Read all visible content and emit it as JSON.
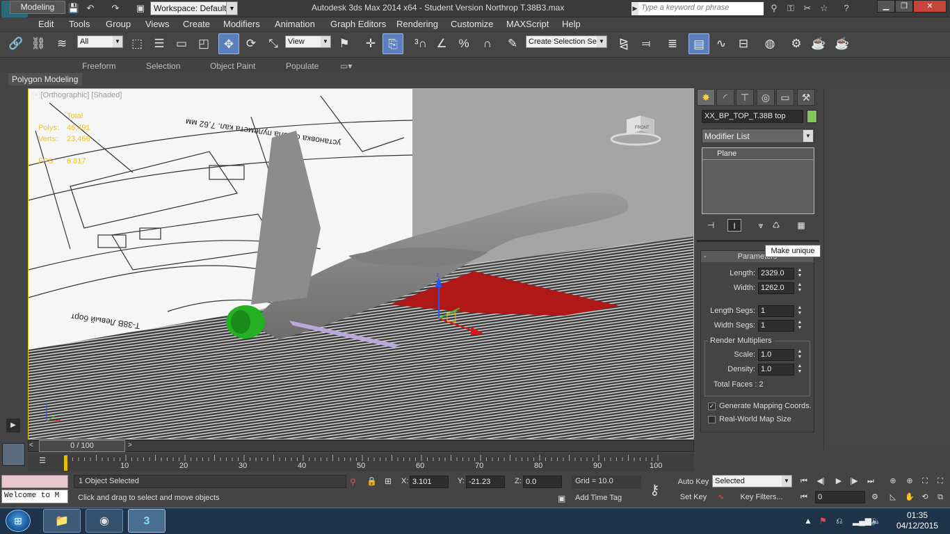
{
  "titlebar": {
    "workspace": "Workspace: Default",
    "title": "Autodesk 3ds Max  2014 x64   - Student Version    Northrop T.38B3.max",
    "search_placeholder": "Type a keyword or phrase"
  },
  "menu": [
    "Edit",
    "Tools",
    "Group",
    "Views",
    "Create",
    "Modifiers",
    "Animation",
    "Graph Editors",
    "Rendering",
    "Customize",
    "MAXScript",
    "Help"
  ],
  "toolbar": {
    "filter": "All",
    "ref_coord": "View",
    "selection_set_placeholder": "Create Selection Se"
  },
  "ribbon": {
    "tabs": [
      "Modeling",
      "Freeform",
      "Selection",
      "Object Paint",
      "Populate"
    ],
    "sub": "Polygon Modeling"
  },
  "viewport": {
    "label_bracket": "[+]",
    "label_view": "[Orthographic]",
    "label_shade": "[Shaded]",
    "stats_header": "Total",
    "polys_label": "Polys:",
    "polys_value": "46,491",
    "verts_label": "Verts:",
    "verts_value": "23,466",
    "fps_label": "FPS:",
    "fps_value": "6.817",
    "viewcube": "FRONT",
    "blueprint_text_1": "T-38B  Левый борт",
    "blueprint_text_2": "установка ствола пулемета кал. 7,62 мм"
  },
  "command_panel": {
    "object_name": "XX_BP_TOP_T.38B top",
    "object_color": "#86c65a",
    "modifier_list": "Modifier List",
    "stack_item": "Plane",
    "tooltip": "Make unique",
    "rollout_title": "Parameters",
    "length_label": "Length:",
    "length_value": "2329.0",
    "width_label": "Width:",
    "width_value": "1262.0",
    "length_segs_label": "Length Segs:",
    "length_segs_value": "1",
    "width_segs_label": "Width Segs:",
    "width_segs_value": "1",
    "render_mult_title": "Render Multipliers",
    "scale_label": "Scale:",
    "scale_value": "1.0",
    "density_label": "Density:",
    "density_value": "1.0",
    "total_faces": "Total Faces : 2",
    "gen_mapping": "Generate Mapping Coords.",
    "gen_mapping_checked": true,
    "real_world": "Real-World Map Size",
    "real_world_checked": false
  },
  "timeline": {
    "slider": "0 / 100",
    "ticks": [
      "10",
      "20",
      "30",
      "40",
      "50",
      "60",
      "70",
      "80",
      "90",
      "100"
    ]
  },
  "status": {
    "maxscript": "Welcome to M",
    "selection": "1 Object Selected",
    "prompt": "Click and drag to select and move objects",
    "x_label": "X:",
    "x_value": "3.101",
    "y_label": "Y:",
    "y_value": "-21.23",
    "z_label": "Z:",
    "z_value": "0.0",
    "grid": "Grid = 10.0",
    "add_time_tag": "Add Time Tag",
    "auto_key": "Auto Key",
    "set_key": "Set Key",
    "key_mode": "Selected",
    "key_filters": "Key Filters...",
    "frame": "0"
  },
  "taskbar": {
    "time": "01:35",
    "date": "04/12/2015"
  },
  "colors": {
    "accent": "#e5c000",
    "wing": "#b01818",
    "nozzle": "#23b123",
    "fuselage": "#8a8a8a"
  }
}
